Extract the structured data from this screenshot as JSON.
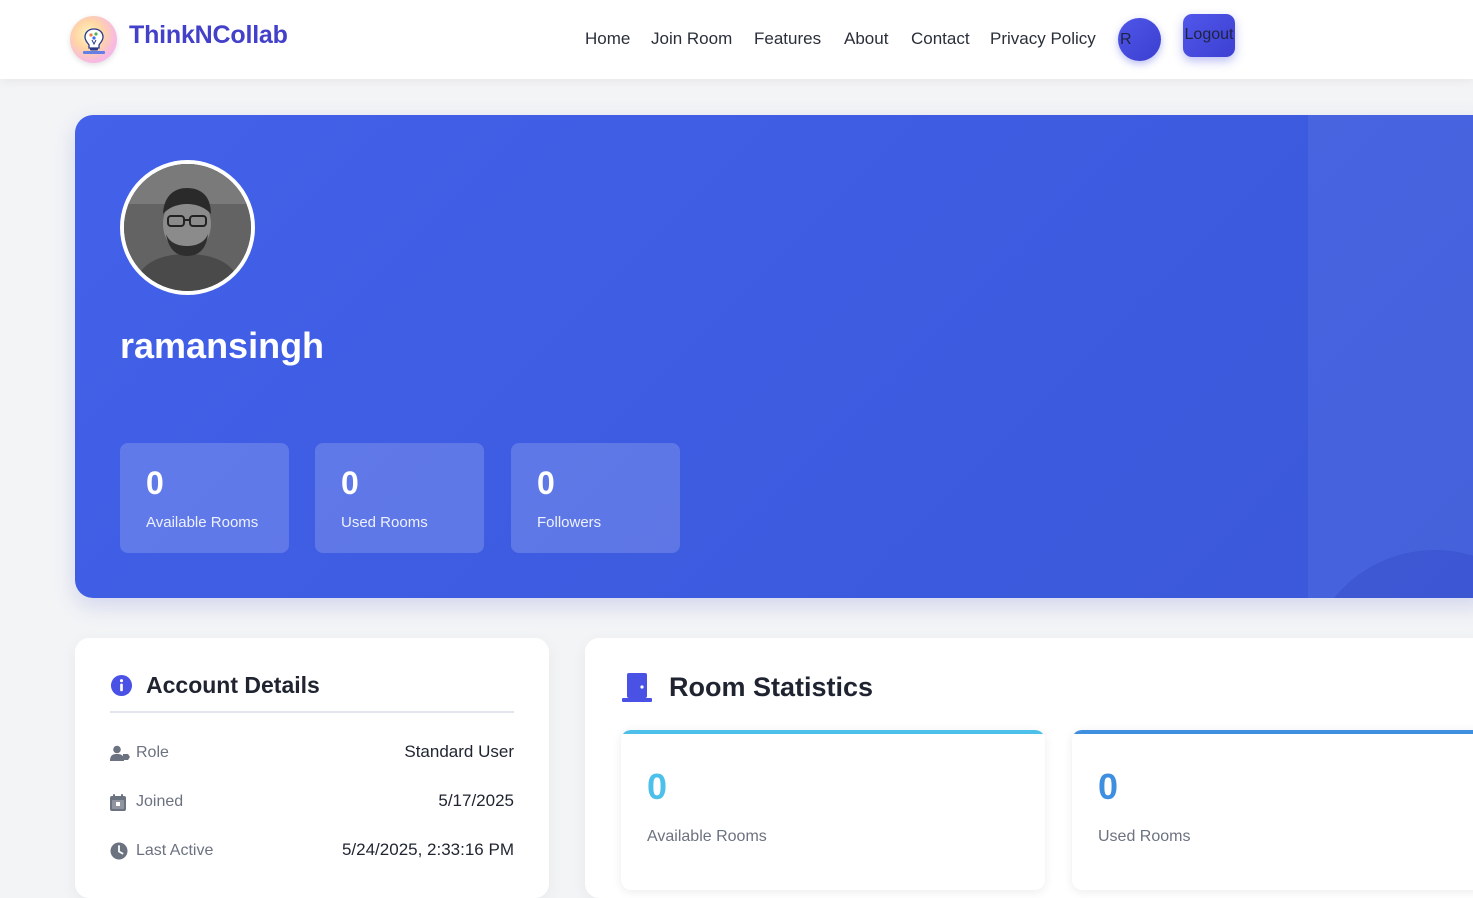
{
  "navbar": {
    "brand": "ThinkNCollab",
    "links": [
      "Home",
      "Join Room",
      "Features",
      "About",
      "Contact",
      "Privacy Policy"
    ],
    "avatar_initial": "R",
    "logout_label": "Logout"
  },
  "profile": {
    "username": "ramansingh",
    "stats": [
      {
        "value": "0",
        "label": "Available Rooms"
      },
      {
        "value": "0",
        "label": "Used Rooms"
      },
      {
        "value": "0",
        "label": "Followers"
      }
    ]
  },
  "account_details": {
    "title": "Account Details",
    "rows": [
      {
        "key": "Role",
        "value": "Standard User",
        "icon": "user-tag-icon"
      },
      {
        "key": "Joined",
        "value": "5/17/2025",
        "icon": "calendar-icon"
      },
      {
        "key": "Last Active",
        "value": "5/24/2025, 2:33:16 PM",
        "icon": "clock-icon"
      }
    ]
  },
  "room_statistics": {
    "title": "Room Statistics",
    "cards": [
      {
        "value": "0",
        "label": "Available Rooms",
        "color": "#4cc0ea"
      },
      {
        "value": "0",
        "label": "Used Rooms",
        "color": "#3f8fe0"
      }
    ]
  },
  "colors": {
    "brand": "#4340c9",
    "hero_bg": "#4361e9",
    "accent": "#4a52e6"
  }
}
